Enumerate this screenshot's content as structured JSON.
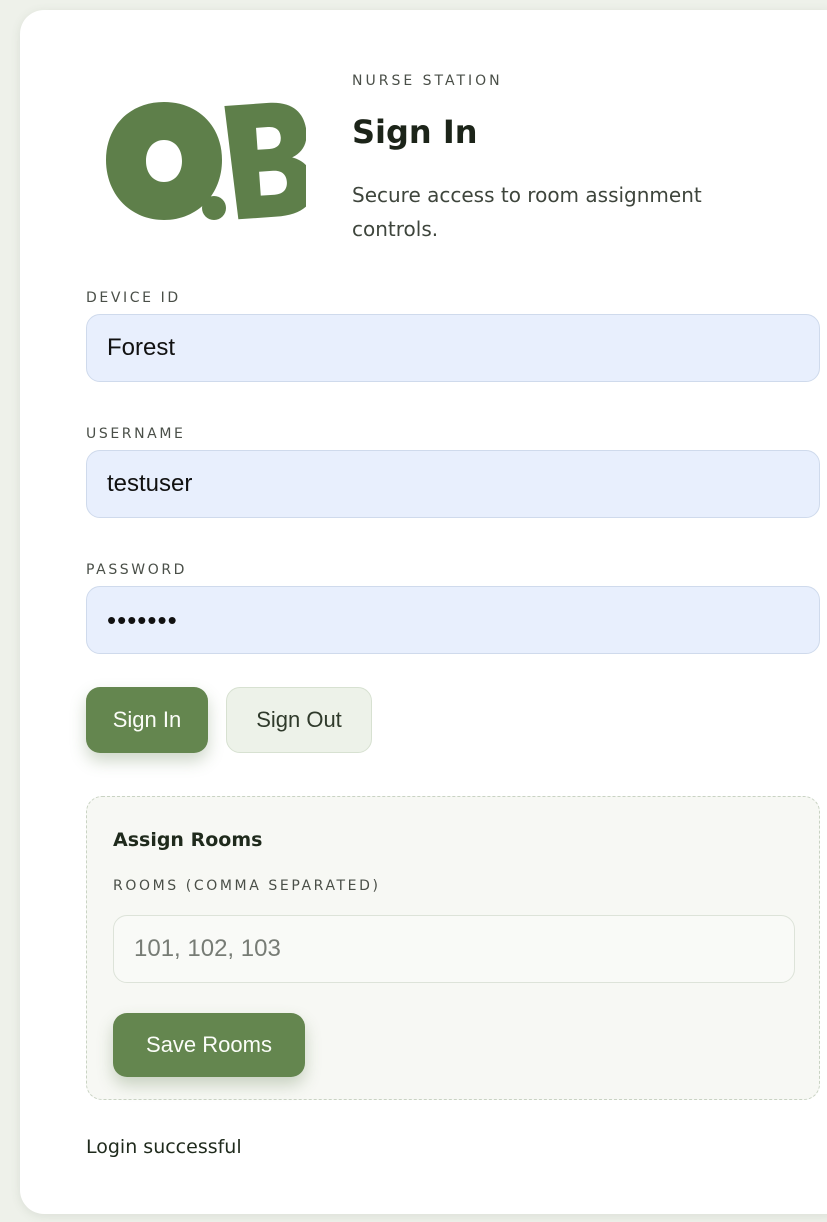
{
  "brand": {
    "logo_text": "O.B",
    "logo_color": "#5e7f4a"
  },
  "header": {
    "eyebrow": "NURSE STATION",
    "title": "Sign In",
    "subtitle": "Secure access to room assignment controls."
  },
  "form": {
    "device_id": {
      "label": "DEVICE ID",
      "value": "Forest"
    },
    "username": {
      "label": "USERNAME",
      "value": "testuser"
    },
    "password": {
      "label": "PASSWORD",
      "value": "sevench"
    }
  },
  "actions": {
    "sign_in_label": "Sign In",
    "sign_out_label": "Sign Out"
  },
  "assign_rooms": {
    "title": "Assign Rooms",
    "rooms_label": "ROOMS (COMMA SEPARATED)",
    "rooms_placeholder": "101, 102, 103",
    "rooms_value": "",
    "save_label": "Save Rooms"
  },
  "status": {
    "message": "Login successful"
  },
  "colors": {
    "accent": "#64864f",
    "background": "#eef1ea",
    "input_autofill": "#e8effd"
  }
}
